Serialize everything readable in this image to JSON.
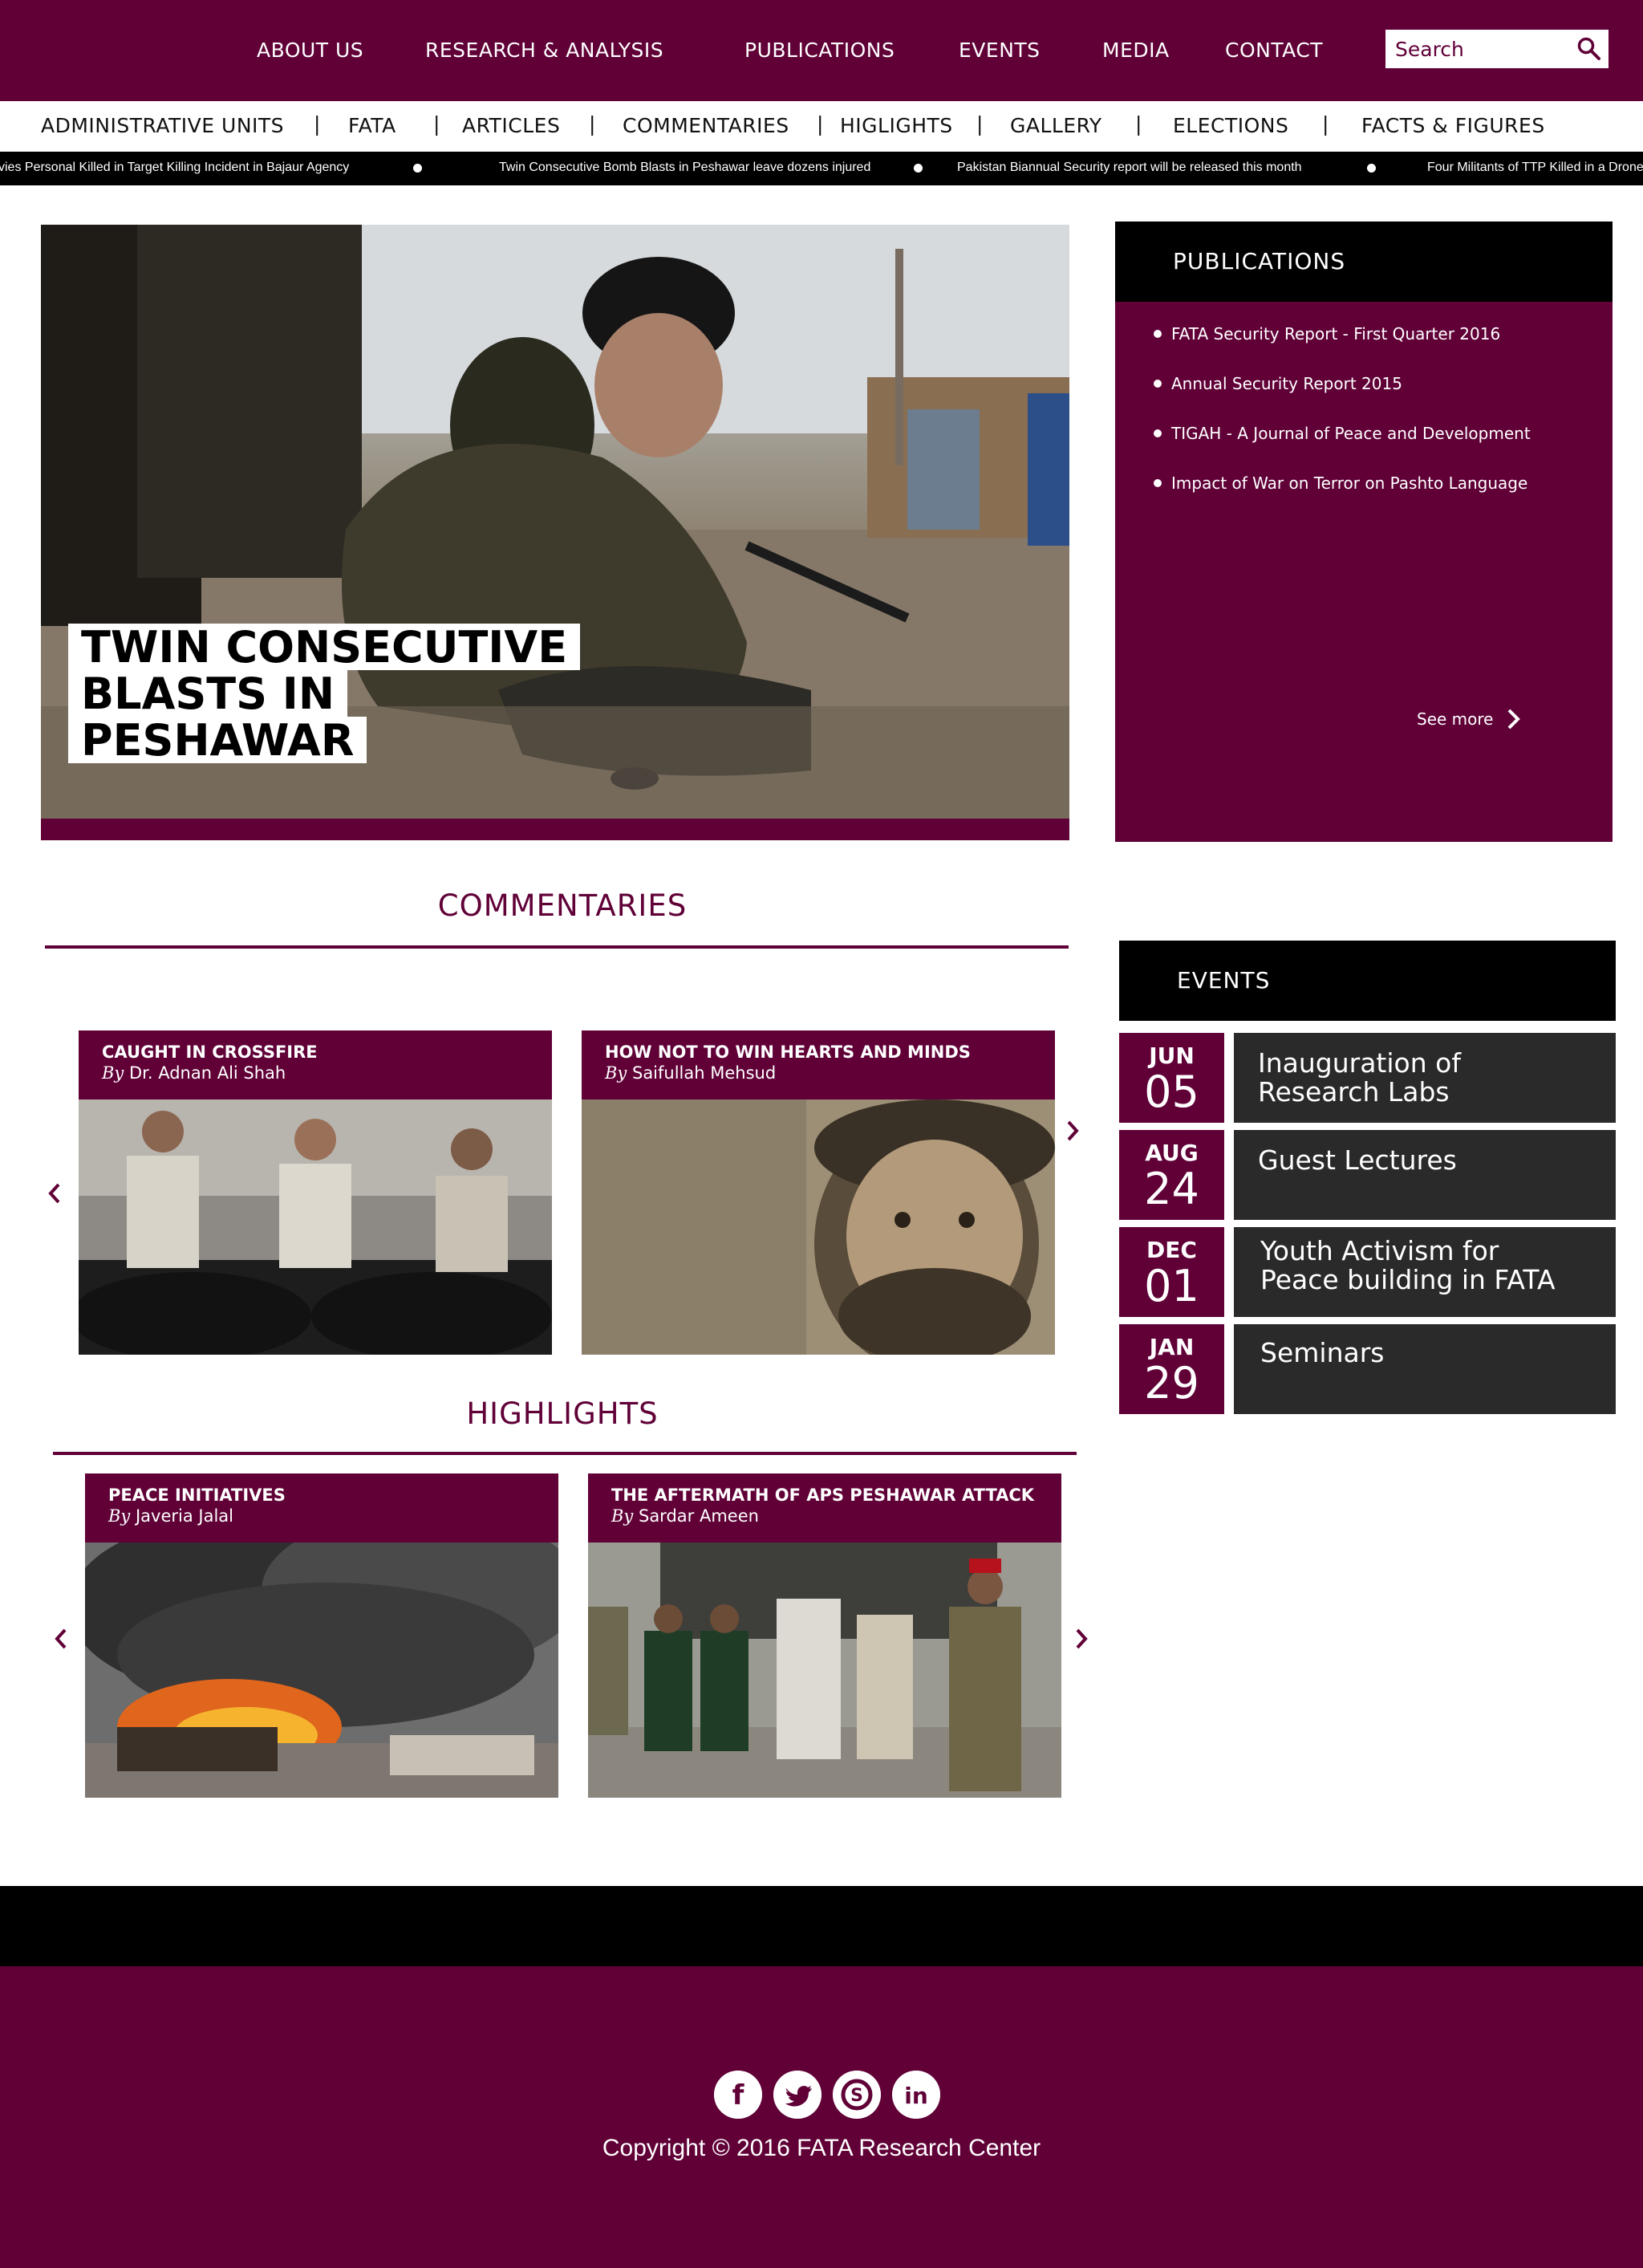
{
  "topnav": {
    "items": [
      "ABOUT US",
      "RESEARCH & ANALYSIS",
      "PUBLICATIONS",
      "EVENTS",
      "MEDIA",
      "CONTACT"
    ],
    "search_placeholder": "Search"
  },
  "subnav": {
    "items": [
      "ADMINISTRATIVE UNITS",
      "FATA",
      "ARTICLES",
      "COMMENTARIES",
      "HIGLIGHTS",
      "GALLERY",
      "ELECTIONS",
      "FACTS & FIGURES"
    ]
  },
  "ticker": {
    "items": [
      "vies Personal Killed in Target Killing Incident in Bajaur Agency",
      "Twin Consecutive Bomb Blasts in Peshawar leave dozens injured",
      "Pakistan Biannual Security report will be released this month",
      "Four Militants of TTP Killed in a Drone"
    ]
  },
  "hero": {
    "headline_lines": [
      "TWIN CONSECUTIVE",
      "BLASTS IN",
      "PESHAWAR"
    ]
  },
  "publications": {
    "title": "PUBLICATIONS",
    "items": [
      "FATA Security Report - First Quarter 2016",
      "Annual Security Report 2015",
      "TIGAH - A Journal of Peace and Development",
      "Impact of War on Terror on Pashto Language"
    ],
    "see_more": "See more"
  },
  "commentaries": {
    "title": "COMMENTARIES",
    "cards": [
      {
        "title": "CAUGHT IN CROSSFIRE",
        "by": "By",
        "author": "Dr. Adnan Ali Shah"
      },
      {
        "title": "HOW NOT TO WIN HEARTS AND MINDS",
        "by": "By",
        "author": "Saifullah Mehsud"
      }
    ]
  },
  "highlights": {
    "title": "HIGHLIGHTS",
    "cards": [
      {
        "title": "PEACE INITIATIVES",
        "by": "By",
        "author": "Javeria Jalal"
      },
      {
        "title": "THE AFTERMATH OF APS PESHAWAR ATTACK",
        "by": "By",
        "author": "Sardar Ameen"
      }
    ]
  },
  "events": {
    "title": "EVENTS",
    "items": [
      {
        "month": "JUN",
        "day": "05",
        "lines": [
          "Inauguration of",
          "Research Labs"
        ]
      },
      {
        "month": "AUG",
        "day": "24",
        "lines": [
          "Guest Lectures",
          ""
        ]
      },
      {
        "month": "DEC",
        "day": "01",
        "lines": [
          "Youth Activism for",
          "Peace building in FATA"
        ]
      },
      {
        "month": "JAN",
        "day": "29",
        "lines": [
          "Seminars",
          ""
        ]
      }
    ]
  },
  "footer": {
    "social": [
      "facebook-icon",
      "twitter-icon",
      "skype-icon",
      "linkedin-icon"
    ],
    "copyright": "Copyright © 2016 FATA Research Center"
  },
  "colors": {
    "brand": "#600037",
    "black": "#000000",
    "event_box": "#2a2a2a"
  }
}
